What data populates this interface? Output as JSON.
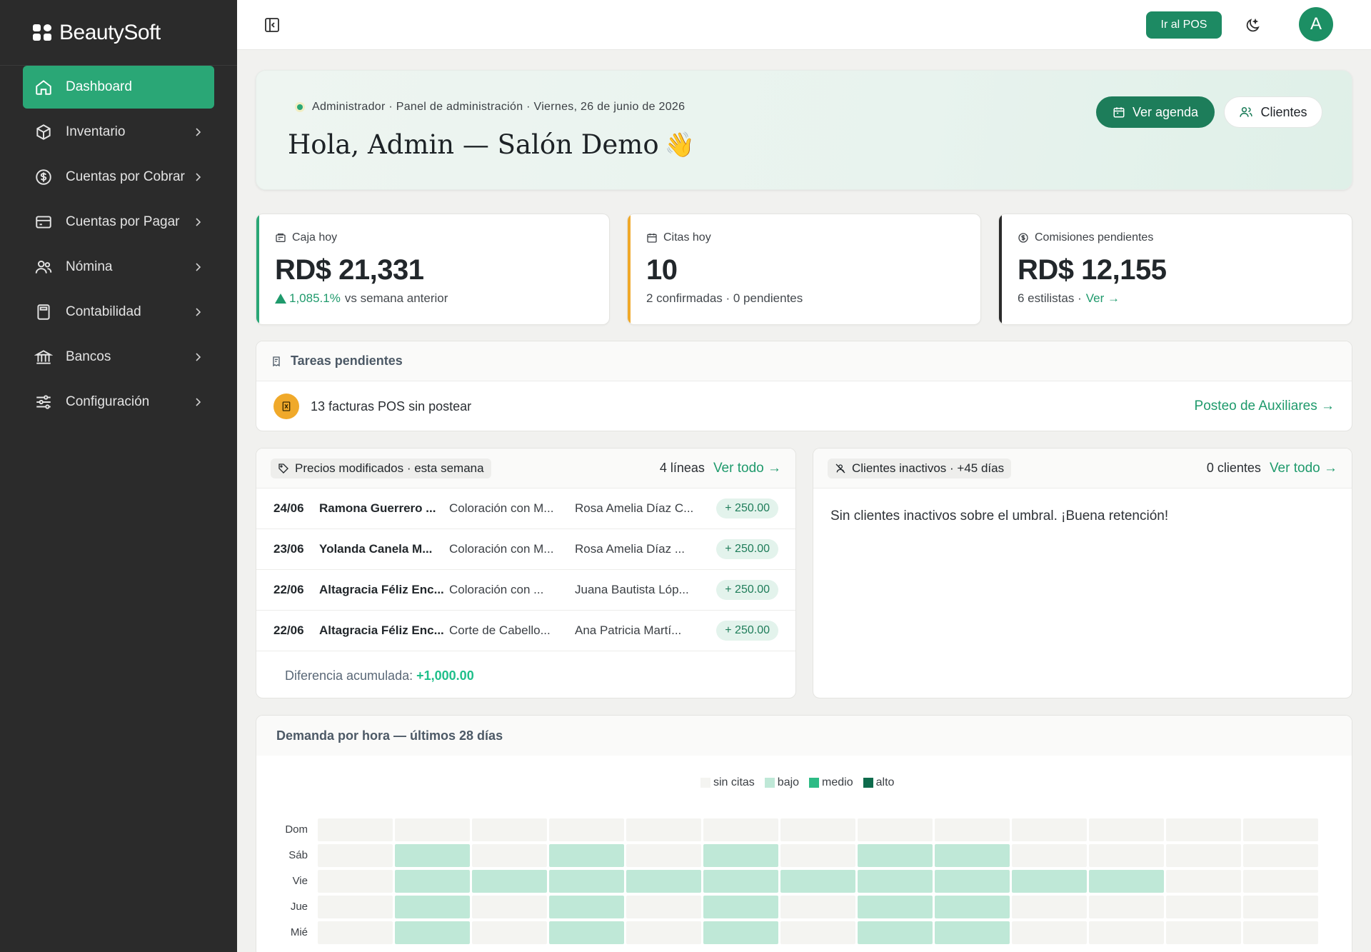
{
  "brand": {
    "name": "BeautySoft"
  },
  "sidebar": {
    "items": [
      {
        "label": "Dashboard",
        "icon": "home-icon",
        "active": true
      },
      {
        "label": "Inventario",
        "icon": "box-icon"
      },
      {
        "label": "Cuentas por Cobrar",
        "icon": "dollar-circle-icon"
      },
      {
        "label": "Cuentas por Pagar",
        "icon": "credit-card-icon"
      },
      {
        "label": "Nómina",
        "icon": "users-icon"
      },
      {
        "label": "Contabilidad",
        "icon": "calculator-icon"
      },
      {
        "label": "Bancos",
        "icon": "bank-icon"
      },
      {
        "label": "Configuración",
        "icon": "sliders-icon"
      }
    ]
  },
  "topbar": {
    "pos_label": "Ir al POS",
    "avatar_letter": "A"
  },
  "hero": {
    "meta": "Administrador · Panel de administración · Viernes, 26 de junio de 2026",
    "title": "Hola, Admin — Salón Demo",
    "emoji": "👋",
    "agenda_label": "Ver agenda",
    "clientes_label": "Clientes"
  },
  "kpis": {
    "caja": {
      "label": "Caja hoy",
      "value": "RD$ 21,331",
      "delta": "1,085.1%",
      "delta_suffix": "vs semana anterior",
      "accent": "#2aa776"
    },
    "citas": {
      "label": "Citas hoy",
      "value": "10",
      "sub": "2 confirmadas · 0 pendientes",
      "accent": "#f0a92a"
    },
    "comisiones": {
      "label": "Comisiones pendientes",
      "value": "RD$ 12,155",
      "sub": "6 estilistas ·",
      "link": "Ver →",
      "accent": "#2b2b2b"
    }
  },
  "tasks": {
    "title": "Tareas pendientes",
    "item": "13 facturas POS sin postear",
    "link": "Posteo de Auxiliares →"
  },
  "precios": {
    "title": "Precios modificados · esta semana",
    "count": "4 líneas",
    "link": "Ver todo →",
    "rows": [
      {
        "date": "24/06",
        "client": "Ramona Guerrero ...",
        "service": "Coloración con M...",
        "stylist": "Rosa Amelia Díaz C...",
        "amount": "+ 250.00"
      },
      {
        "date": "23/06",
        "client": "Yolanda Canela M...",
        "service": "Coloración con M...",
        "stylist": "Rosa Amelia Díaz ...",
        "amount": "+ 250.00"
      },
      {
        "date": "22/06",
        "client": "Altagracia Féliz Enc...",
        "service": "Coloración con ...",
        "stylist": "Juana Bautista Lóp...",
        "amount": "+ 250.00"
      },
      {
        "date": "22/06",
        "client": "Altagracia Féliz Enc...",
        "service": "Corte de Cabello...",
        "stylist": "Ana Patricia Martí...",
        "amount": "+ 250.00"
      }
    ],
    "diff_label": "Diferencia acumulada:",
    "diff_value": "+1,000.00"
  },
  "inactivos": {
    "title": "Clientes inactivos · +45 días",
    "count": "0 clientes",
    "link": "Ver todo →",
    "empty": "Sin clientes inactivos sobre el umbral. ¡Buena retención!"
  },
  "demand": {
    "title": "Demanda por hora — últimos 28 días",
    "legend": [
      {
        "label": "sin citas",
        "color": "#f4f4f1"
      },
      {
        "label": "bajo",
        "color": "#bfe8d7"
      },
      {
        "label": "medio",
        "color": "#2dbb85"
      },
      {
        "label": "alto",
        "color": "#0e6b4c"
      }
    ],
    "days": [
      "Dom",
      "Sáb",
      "Vie",
      "Jue",
      "Mié"
    ],
    "levels": [
      [
        0,
        0,
        0,
        0,
        0,
        0,
        0,
        0,
        0,
        0,
        0,
        0,
        0
      ],
      [
        0,
        1,
        0,
        1,
        0,
        1,
        0,
        1,
        1,
        0,
        0,
        0,
        0
      ],
      [
        0,
        1,
        1,
        1,
        1,
        1,
        1,
        1,
        1,
        1,
        1,
        0,
        0
      ],
      [
        0,
        1,
        0,
        1,
        0,
        1,
        0,
        1,
        1,
        0,
        0,
        0,
        0
      ],
      [
        0,
        1,
        0,
        1,
        0,
        1,
        0,
        1,
        1,
        0,
        0,
        0,
        0
      ]
    ]
  }
}
